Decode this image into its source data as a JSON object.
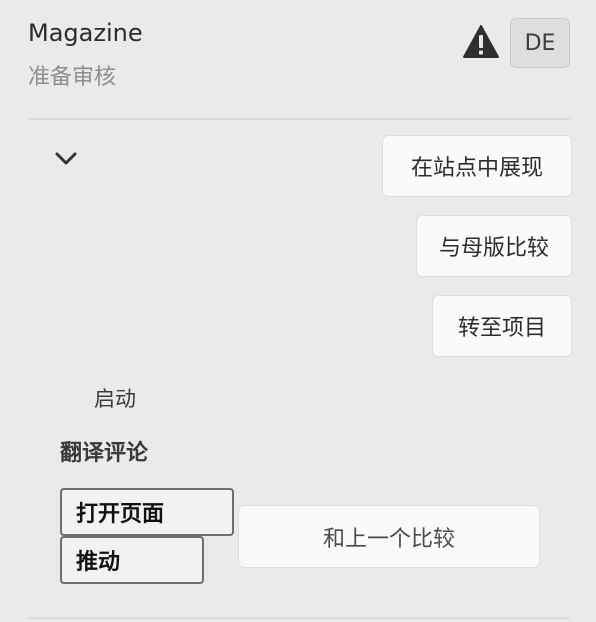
{
  "header": {
    "title": "Magazine",
    "status": "准备审核",
    "warning_icon": "warning-icon",
    "language_code": "DE"
  },
  "actions": {
    "expand_icon": "chevron-down-icon",
    "view_in_site": "在站点中展现",
    "compare_with_master": "与母版比较",
    "go_to_project": "转至项目"
  },
  "launch": {
    "label": "启动"
  },
  "translation_review": {
    "heading": "翻译评论",
    "open_page": "打开页面",
    "promote": "推动",
    "compare_with_previous": "和上一个比较"
  }
}
